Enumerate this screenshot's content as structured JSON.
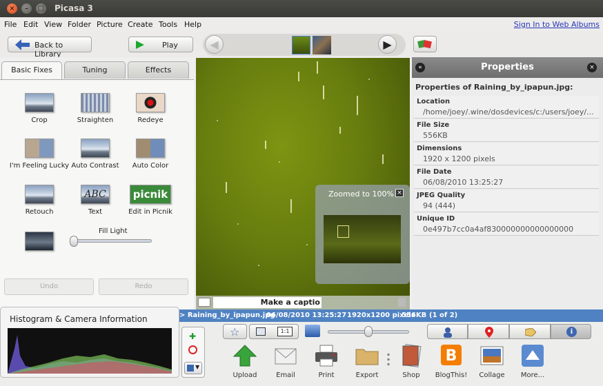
{
  "window": {
    "title": "Picasa 3"
  },
  "menu": {
    "items": [
      "File",
      "Edit",
      "View",
      "Folder",
      "Picture",
      "Create",
      "Tools",
      "Help"
    ],
    "signin": "Sign In to Web Albums"
  },
  "toolbar": {
    "back_label": "Back to Library",
    "play_label": "Play"
  },
  "tabs": [
    "Basic Fixes",
    "Tuning",
    "Effects"
  ],
  "tools": [
    {
      "label": "Crop"
    },
    {
      "label": "Straighten"
    },
    {
      "label": "Redeye"
    },
    {
      "label": "I'm Feeling Lucky"
    },
    {
      "label": "Auto Contrast"
    },
    {
      "label": "Auto Color"
    },
    {
      "label": "Retouch"
    },
    {
      "label": "Text"
    },
    {
      "label": "Edit in Picnik"
    }
  ],
  "fill_light": {
    "label": "Fill Light",
    "value": 0
  },
  "undo_label": "Undo",
  "redo_label": "Redo",
  "text_icon": "ABC",
  "picnik_logo": "picnik",
  "zoom": {
    "title": "Zoomed to 100%"
  },
  "caption": {
    "text": "Make a captio"
  },
  "properties": {
    "title": "Properties",
    "subtitle": "Properties of Raining_by_ipapun.jpg:",
    "rows": [
      {
        "key": "Location",
        "value": "/home/joey/.wine/dosdevices/c:/users/joey/..."
      },
      {
        "key": "File Size",
        "value": "556KB"
      },
      {
        "key": "Dimensions",
        "value": "1920 x 1200 pixels"
      },
      {
        "key": "File Date",
        "value": "06/08/2010 13:25:27"
      },
      {
        "key": "JPEG Quality",
        "value": "94 (444)"
      },
      {
        "key": "Unique ID",
        "value": "0e497b7cc0a4af830000000000000000"
      }
    ]
  },
  "status": {
    "filename": "> Raining_by_ipapun.jpg",
    "date": "06/08/2010 13:25:27",
    "dims": "1920x1200 pixels",
    "size": "556KB",
    "count": "(1 of 2)"
  },
  "histogram": {
    "title": "Histogram & Camera Information"
  },
  "view_buttons": {
    "actual_size": "1:1"
  },
  "actions": [
    "Upload",
    "Email",
    "Print",
    "Export",
    "Shop",
    "BlogThis!",
    "Collage",
    "More..."
  ]
}
